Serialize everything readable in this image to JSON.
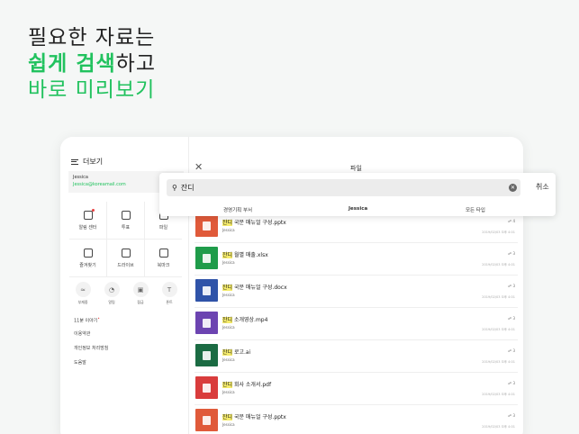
{
  "headline": {
    "line1": "필요한 자료는",
    "line2_bold": "쉽게 검색",
    "line2_rest": "하고",
    "line3": "바로 미리보기"
  },
  "sidebar": {
    "title": "더보기",
    "user_name": "Jessica",
    "user_email": "Jessica@koreamail.com",
    "grid": [
      [
        {
          "label": "알림 센터",
          "icon": "bell-box-icon",
          "badge": true
        },
        {
          "label": "투표",
          "icon": "vote-icon"
        },
        {
          "label": "파일",
          "icon": "file-icon"
        }
      ],
      [
        {
          "label": "즐겨찾기",
          "icon": "star-icon"
        },
        {
          "label": "드라이브",
          "icon": "drive-icon"
        },
        {
          "label": "북마크",
          "icon": "bookmark-icon"
        }
      ]
    ],
    "circles": [
      {
        "label": "부재중",
        "icon": "away-icon",
        "glyph": "≈"
      },
      {
        "label": "알림",
        "icon": "bell-icon",
        "glyph": "◔"
      },
      {
        "label": "잠금",
        "icon": "lock-icon",
        "glyph": "▣"
      },
      {
        "label": "폰트",
        "icon": "font-icon",
        "glyph": "T"
      }
    ],
    "links": [
      "11분 이야기",
      "이용약관",
      "개인정보 처리방침",
      "도움말"
    ]
  },
  "main": {
    "title": "파일",
    "search": {
      "value": "잔디",
      "cancel": "취소"
    },
    "filters": {
      "dept": "경영기획 부서",
      "person": "Jessica",
      "type": "모든 타입"
    }
  },
  "files": [
    {
      "hl": "잔디",
      "rest": " 국문 매뉴얼 구성.pptx",
      "owner": "Jessica",
      "count": "4",
      "date": "2019/02/03 오후 4:01",
      "color": "#e05a3a"
    },
    {
      "hl": "잔디",
      "rest": " 월별 매출.xlsx",
      "owner": "Jessica",
      "count": "3",
      "date": "2019/02/03 오후 4:01",
      "color": "#1f9c4a"
    },
    {
      "hl": "잔디",
      "rest": " 국문 매뉴얼 구성.docx",
      "owner": "Jessica",
      "count": "3",
      "date": "2019/02/03 오후 4:01",
      "color": "#2f53a8"
    },
    {
      "hl": "잔디",
      "rest": " 소개영상.mp4",
      "owner": "Jessica",
      "count": "3",
      "date": "2019/02/03 오후 4:01",
      "color": "#6c44b1"
    },
    {
      "hl": "잔디",
      "rest": " 로고.ai",
      "owner": "Jessica",
      "count": "3",
      "date": "2019/02/03 오후 4:01",
      "color": "#1b6b43"
    },
    {
      "hl": "잔디",
      "rest": " 회사 소개서.pdf",
      "owner": "Jessica",
      "count": "3",
      "date": "2019/02/03 오후 4:01",
      "color": "#d93c3c"
    },
    {
      "hl": "잔디",
      "rest": " 국문 매뉴얼 구성.pptx",
      "owner": "Jessica",
      "count": "3",
      "date": "2019/02/03 오후 4:01",
      "color": "#e05a3a"
    }
  ]
}
